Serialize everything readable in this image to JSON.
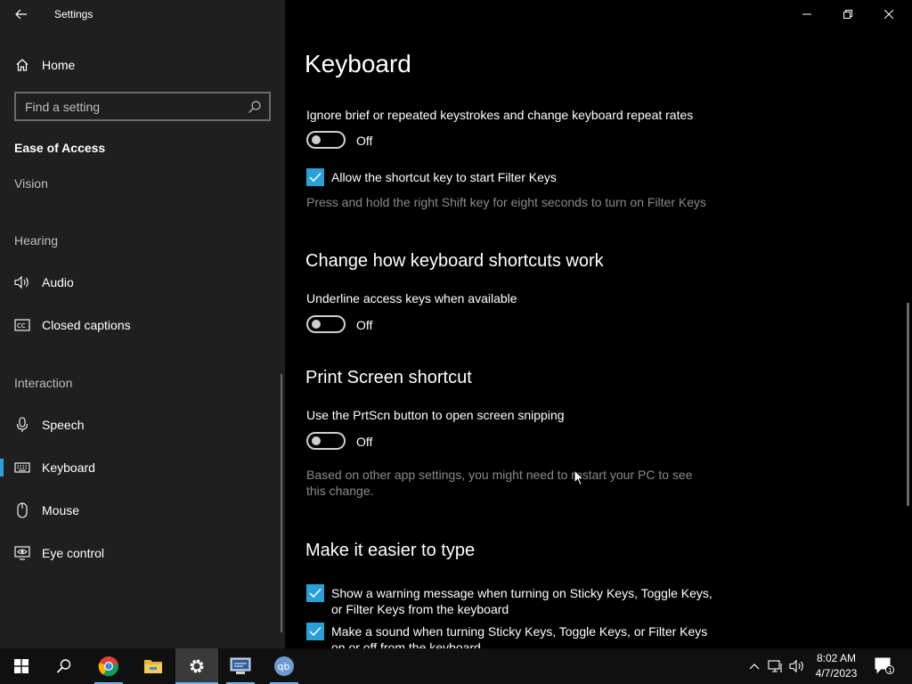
{
  "window": {
    "title": "Settings"
  },
  "sidebar": {
    "home_label": "Home",
    "search_placeholder": "Find a setting",
    "category": "Ease of Access",
    "sections": {
      "vision": "Vision",
      "hearing": "Hearing",
      "interaction": "Interaction"
    },
    "items": [
      {
        "label": "Audio",
        "icon": "speaker-icon"
      },
      {
        "label": "Closed captions",
        "icon": "captions-icon"
      },
      {
        "label": "Speech",
        "icon": "microphone-icon"
      },
      {
        "label": "Keyboard",
        "icon": "keyboard-icon",
        "active": true
      },
      {
        "label": "Mouse",
        "icon": "mouse-icon"
      },
      {
        "label": "Eye control",
        "icon": "eye-icon"
      }
    ]
  },
  "main": {
    "page_title": "Keyboard",
    "filter_keys": {
      "setting_label": "Ignore brief or repeated keystrokes and change keyboard repeat rates",
      "toggle_state": "Off",
      "shortcut_checkbox_label": "Allow the shortcut key to start Filter Keys",
      "shortcut_description": "Press and hold the right Shift key for eight seconds to turn on Filter Keys"
    },
    "shortcuts_section": {
      "heading": "Change how keyboard shortcuts work",
      "setting_label": "Underline access keys when available",
      "toggle_state": "Off"
    },
    "print_screen_section": {
      "heading": "Print Screen shortcut",
      "setting_label": "Use the PrtScn button to open screen snipping",
      "toggle_state": "Off",
      "note": "Based on other app settings, you might need to restart your PC to see this change."
    },
    "typing_section": {
      "heading": "Make it easier to type",
      "warning_checkbox_label": "Show a warning message when turning on Sticky Keys, Toggle Keys, or Filter Keys from the keyboard",
      "sound_checkbox_label": "Make a sound when turning Sticky Keys, Toggle Keys, or Filter Keys on or off from the keyboard"
    }
  },
  "taskbar": {
    "time": "8:02 AM",
    "date": "4/7/2023",
    "notification_count": "1"
  },
  "colors": {
    "accent": "#2aa0d6",
    "sidebar_bg": "#1f1f1f",
    "main_bg": "#000000",
    "taskbar_bg": "#101010"
  }
}
